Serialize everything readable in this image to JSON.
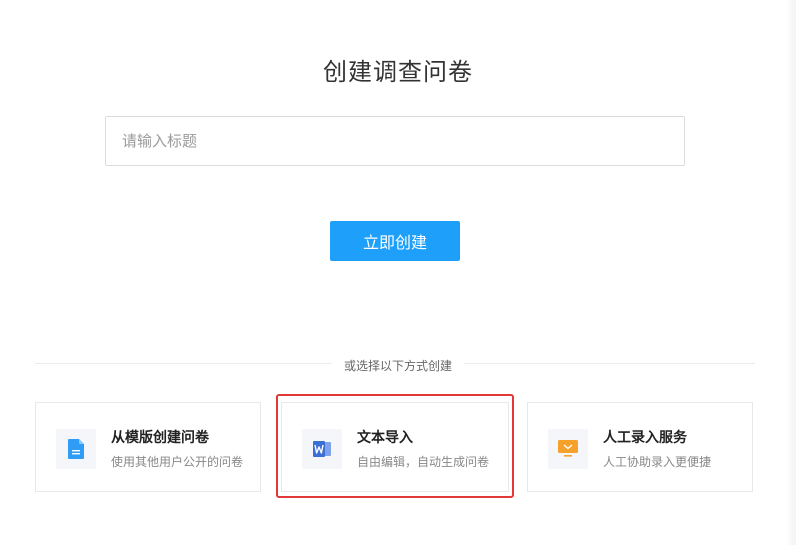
{
  "header": {
    "title": "创建调查问卷"
  },
  "form": {
    "title_placeholder": "请输入标题",
    "title_value": "",
    "create_label": "立即创建"
  },
  "divider": {
    "text": "或选择以下方式创建"
  },
  "options": [
    {
      "title": "从模版创建问卷",
      "desc": "使用其他用户公开的问卷",
      "icon": "document-icon",
      "color": "#2f9cf5"
    },
    {
      "title": "文本导入",
      "desc": "自由编辑，自动生成问卷",
      "icon": "word-icon",
      "color": "#3b6fd6"
    },
    {
      "title": "人工录入服务",
      "desc": "人工协助录入更便捷",
      "icon": "monitor-icon",
      "color": "#f5a12b"
    }
  ],
  "colors": {
    "primary": "#1ea0fa",
    "highlight": "#e23838"
  }
}
